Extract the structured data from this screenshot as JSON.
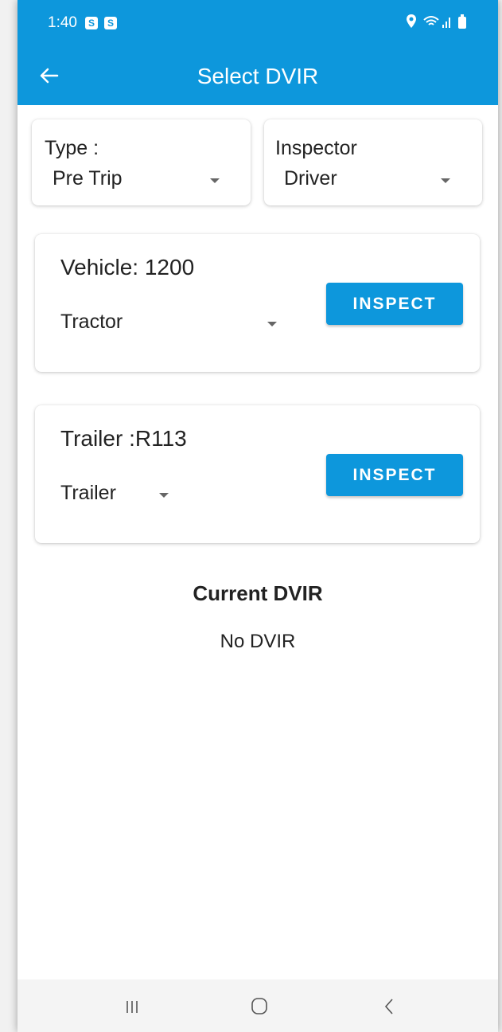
{
  "status_bar": {
    "time": "1:40",
    "badges": [
      "S",
      "S"
    ]
  },
  "app_bar": {
    "title": "Select DVIR",
    "back_icon": "arrow-left-icon"
  },
  "filters": {
    "type": {
      "label": "Type :",
      "value": "Pre Trip"
    },
    "inspector": {
      "label": "Inspector",
      "value": "Driver"
    }
  },
  "vehicle_card": {
    "title": "Vehicle: 1200",
    "selected": "Tractor",
    "button": "INSPECT"
  },
  "trailer_card": {
    "title": "Trailer :R113",
    "selected": "Trailer",
    "button": "INSPECT"
  },
  "current_dvir": {
    "title": "Current DVIR",
    "empty_text": "No DVIR"
  },
  "nav_bar": {
    "icons": [
      "recent-apps-icon",
      "home-icon",
      "back-icon"
    ]
  },
  "colors": {
    "primary": "#0d97dc",
    "text": "#222222"
  }
}
